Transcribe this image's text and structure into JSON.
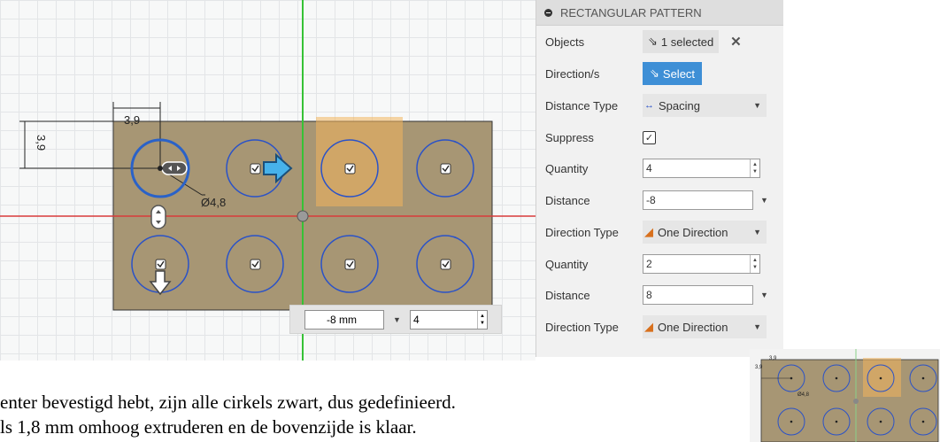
{
  "viewport": {
    "dimension_horizontal": "3,9",
    "dimension_vertical": "3,9",
    "diameter": "Ø4,8",
    "colors": {
      "plate": "#a79674",
      "circle": "#2a52c8",
      "axis_green": "#36c236",
      "axis_red": "#d83b3b",
      "highlight": "#f2b45c"
    }
  },
  "panel": {
    "title": "RECTANGULAR PATTERN",
    "objects_label": "Objects",
    "objects_value": "1 selected",
    "directions_label": "Direction/s",
    "directions_button": "Select",
    "distance_type_label": "Distance Type",
    "distance_type_value": "Spacing",
    "suppress_label": "Suppress",
    "quantity1_label": "Quantity",
    "quantity1_value": "4",
    "distance1_label": "Distance",
    "distance1_value": "-8",
    "direction_type1_label": "Direction Type",
    "direction_type1_value": "One Direction",
    "quantity2_label": "Quantity",
    "quantity2_value": "2",
    "distance2_label": "Distance",
    "distance2_value": "8",
    "direction_type2_label": "Direction Type",
    "direction_type2_value": "One Direction"
  },
  "toolbar": {
    "distance": "-8 mm",
    "quantity": "4"
  },
  "caption": {
    "line1": "enter bevestigd hebt, zijn alle cirkels zwart, dus gedefinieerd.",
    "line2": "ls 1,8 mm omhoog extruderen en de bovenzijde is klaar."
  },
  "thumbnail": {
    "dimension_horizontal": "3,9",
    "dimension_vertical": "3,9",
    "diameter": "Ø4,8"
  }
}
